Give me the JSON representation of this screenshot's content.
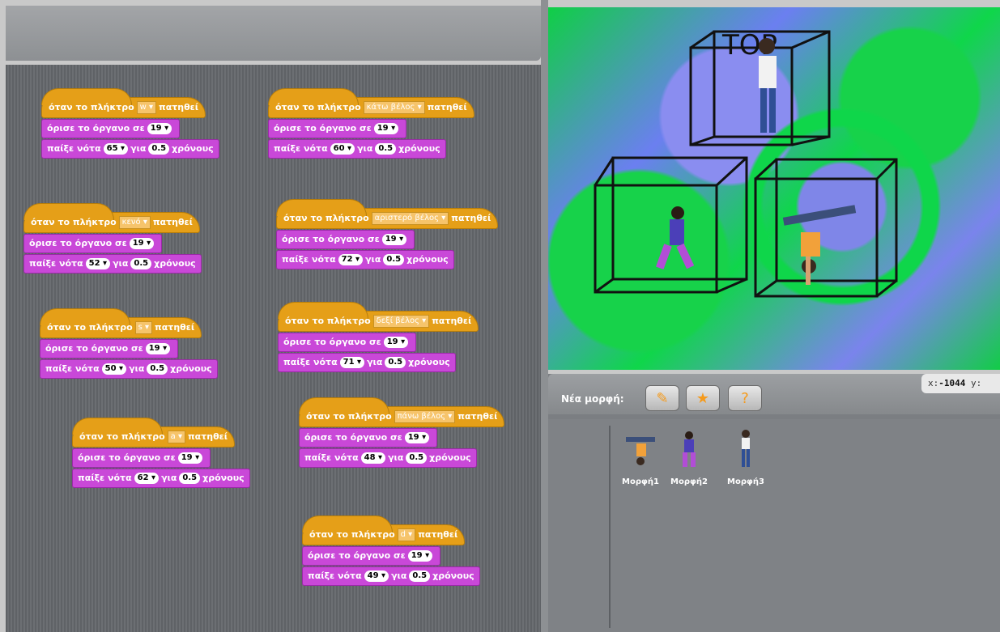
{
  "scripts": [
    {
      "key": "w",
      "note": "65",
      "instrument": "19",
      "dur": "0.5"
    },
    {
      "key": "κάτω βέλος",
      "note": "60",
      "instrument": "19",
      "dur": "0.5"
    },
    {
      "key": "κενό",
      "note": "52",
      "instrument": "19",
      "dur": "0.5"
    },
    {
      "key": "αριστερό βέλος",
      "note": "72",
      "instrument": "19",
      "dur": "0.5"
    },
    {
      "key": "s",
      "note": "50",
      "instrument": "19",
      "dur": "0.5"
    },
    {
      "key": "δεξί βέλος",
      "note": "71",
      "instrument": "19",
      "dur": "0.5"
    },
    {
      "key": "a",
      "note": "62",
      "instrument": "19",
      "dur": "0.5"
    },
    {
      "key": "πάνω βέλος",
      "note": "48",
      "instrument": "19",
      "dur": "0.5"
    },
    {
      "key": "d",
      "note": "49",
      "instrument": "19",
      "dur": "0.5"
    }
  ],
  "labels": {
    "when_key": "όταν το πλήκτρο",
    "pressed": "πατηθεί",
    "set_instrument": "όρισε το όργανο σε",
    "play_note": "παίξε νότα",
    "for": "για",
    "beats": "χρόνους"
  },
  "stage": {
    "title_text": "TOP"
  },
  "sprite_pane": {
    "new_costume_label": "Νέα μορφή:",
    "x_label": "x:",
    "x_value": "-1044",
    "y_label": "y:",
    "costumes": [
      "Μορφή1",
      "Μορφή2",
      "Μορφή3"
    ]
  },
  "colors": {
    "hat": "#e59f18",
    "sound": "#c948d8",
    "stage_green": "#0fd64a",
    "stage_blue": "#7f86e8"
  }
}
